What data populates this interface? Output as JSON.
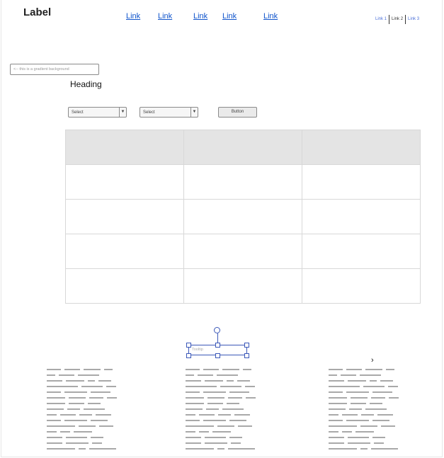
{
  "header": {
    "title": "Label",
    "links": [
      "Link",
      "Link",
      "Link",
      "Link",
      "Link"
    ]
  },
  "breadcrumb": {
    "items": [
      "Link 1",
      "Link 2",
      "Link 3"
    ],
    "current_index": 1
  },
  "gradient_input": {
    "placeholder": "<-- this is a gradient background"
  },
  "heading": "Heading",
  "controls": {
    "select1": "Select",
    "select2": "Select",
    "button": "Button"
  },
  "selected_element": {
    "placeholder": "Tooltip"
  },
  "colors": {
    "link": "#1155cc",
    "selection": "#3a57b8",
    "table_header_bg": "#e4e4e4"
  },
  "icons": {
    "dropdown": "triangle-down",
    "next": "chevron-right"
  }
}
